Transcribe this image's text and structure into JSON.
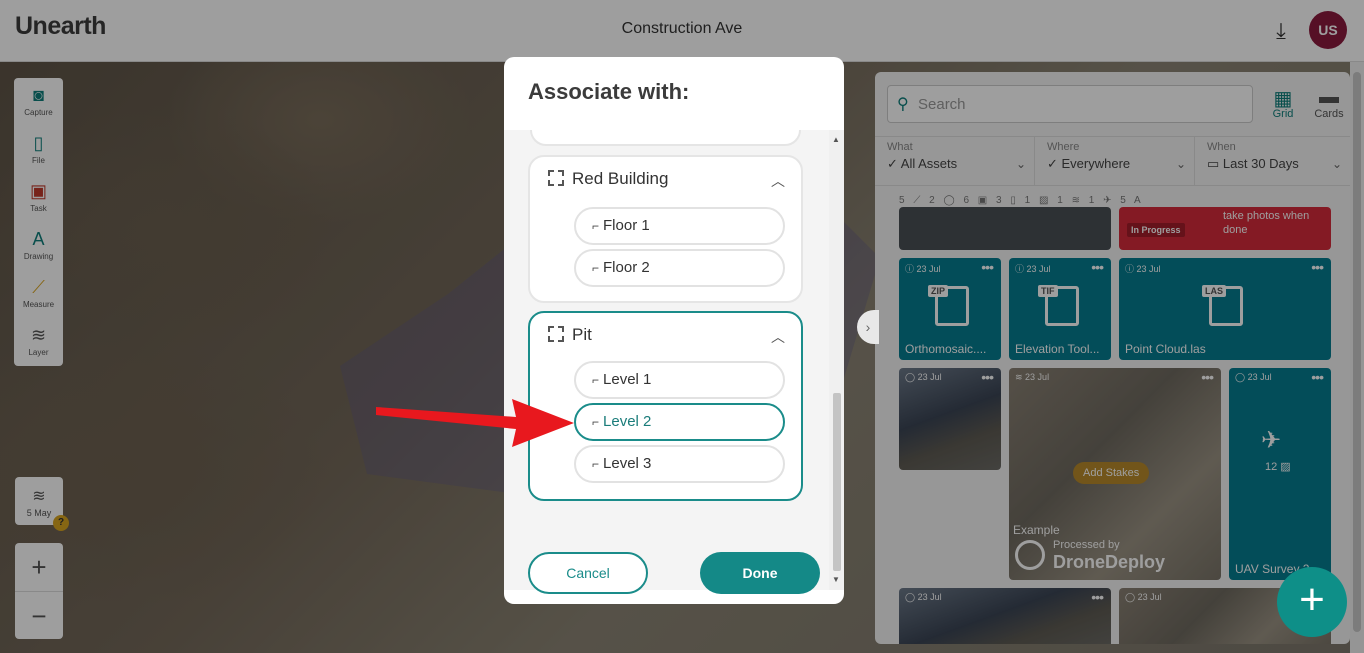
{
  "app": {
    "logo": "Unearth",
    "title": "Construction Ave",
    "avatar": "US"
  },
  "icons": {
    "download": "download-icon"
  },
  "tools": [
    {
      "label": "Capture",
      "icon": "camera-icon",
      "glyph": "◙"
    },
    {
      "label": "File",
      "icon": "file-icon",
      "glyph": "▯"
    },
    {
      "label": "Task",
      "icon": "clipboard-icon",
      "glyph": "▣"
    },
    {
      "label": "Drawing",
      "icon": "drawing-icon",
      "glyph": "A"
    },
    {
      "label": "Measure",
      "icon": "ruler-icon",
      "glyph": "⟋"
    },
    {
      "label": "Layer",
      "icon": "layers-icon",
      "glyph": "≋"
    }
  ],
  "date_control": {
    "label": "5 May",
    "help": "?"
  },
  "zoom": {
    "in": "+",
    "out": "−"
  },
  "panel": {
    "search_placeholder": "Search",
    "views": [
      {
        "label": "Grid",
        "active": true
      },
      {
        "label": "Cards",
        "active": false
      }
    ],
    "filters": [
      {
        "key": "What",
        "value": "All Assets"
      },
      {
        "key": "Where",
        "value": "Everywhere"
      },
      {
        "key": "When",
        "value": "Last 30 Days"
      }
    ],
    "counts": [
      "5",
      "2",
      "6",
      "3",
      "1",
      "1",
      "1",
      "5"
    ],
    "top_card": {
      "status": "In Progress",
      "text": "take photos when done"
    },
    "cards": [
      {
        "date": "23 Jul",
        "ext": "ZIP",
        "name": "Orthomosaic...."
      },
      {
        "date": "23 Jul",
        "ext": "TIF",
        "name": "Elevation Tool..."
      },
      {
        "date": "23 Jul",
        "ext": "LAS",
        "name": "Point Cloud.las"
      },
      {
        "date": "23 Jul",
        "name": ""
      },
      {
        "date": "23 Jul",
        "name": "Example",
        "badge": "Add Stakes",
        "brand_small": "Processed by",
        "brand": "DroneDeploy"
      },
      {
        "date": "23 Jul",
        "name": "UAV Survey 2...",
        "count": "12"
      },
      {
        "date": "23 Jul",
        "name": ""
      },
      {
        "date": "23 Jul",
        "name": ""
      }
    ]
  },
  "modal": {
    "title": "Associate with:",
    "groups": [
      {
        "name": "Red Building",
        "levels": [
          "Floor 1",
          "Floor 2"
        ]
      },
      {
        "name": "Pit",
        "levels": [
          "Level 1",
          "Level 2",
          "Level 3"
        ],
        "selected_level": "Level 2"
      }
    ],
    "cancel": "Cancel",
    "done": "Done"
  },
  "colors": {
    "accent": "#148987",
    "brand": "#0e7f7b",
    "avatar": "#8b1a3e",
    "arrow": "#e8181e"
  }
}
